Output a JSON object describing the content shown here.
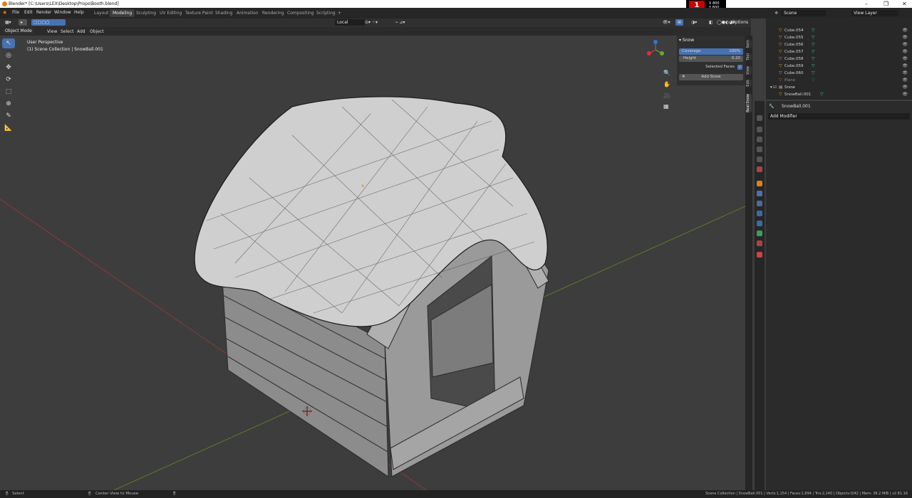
{
  "window": {
    "title": "Blender* [C:\\Users\\LEX\\Desktop\\Props\\Booth.blend]",
    "overlay_number": "1",
    "overlay_x": "X 800",
    "overlay_y": "Y 800"
  },
  "menus": [
    "File",
    "Edit",
    "Render",
    "Window",
    "Help"
  ],
  "workspaces": [
    "Layout",
    "Modeling",
    "Sculpting",
    "UV Editing",
    "Texture Paint",
    "Shading",
    "Animation",
    "Rendering",
    "Compositing",
    "Scripting"
  ],
  "active_workspace": "Modeling",
  "scene": {
    "name": "Scene",
    "view_layer": "View Layer"
  },
  "viewport_header": {
    "orientation": "Local",
    "options": "Options",
    "mode": "Object Mode",
    "menus": [
      "View",
      "Select",
      "Add",
      "Object"
    ]
  },
  "viewport": {
    "perspective": "User Perspective",
    "collection_info": "(1) Scene Collection | SnowBall.001"
  },
  "npanel": {
    "title": "Snow",
    "coverage_label": "Coverage",
    "coverage_value": "100%",
    "height_label": "Height",
    "height_value": "0.20",
    "selected_faces_label": "Selected Faces",
    "add_button": "Add Snow",
    "tabs": [
      "Item",
      "Tool",
      "View",
      "Edit",
      "Real Snow"
    ]
  },
  "outliner": {
    "items": [
      {
        "name": "Cube.054",
        "type": "mesh"
      },
      {
        "name": "Cube.055",
        "type": "mesh"
      },
      {
        "name": "Cube.056",
        "type": "mesh"
      },
      {
        "name": "Cube.057",
        "type": "mesh"
      },
      {
        "name": "Cube.058",
        "type": "mesh"
      },
      {
        "name": "Cube.059",
        "type": "mesh"
      },
      {
        "name": "Cube.060",
        "type": "mesh"
      },
      {
        "name": "Plane",
        "type": "mesh-dim"
      },
      {
        "name": "Snow",
        "type": "collection"
      },
      {
        "name": "SnowBall.001",
        "type": "mesh-active"
      }
    ]
  },
  "properties": {
    "object_name": "SnowBall.001",
    "add_modifier": "Add Modifier"
  },
  "status": {
    "select": "Select",
    "center_view": "Center View to Mouse",
    "stats": "Scene Collection | SnowBall.001 | Verts:1,154 | Faces:1,894 | Tris:2,140 | Objects:0/42 | Mem: 38.2 MiB | v2.81.16"
  }
}
